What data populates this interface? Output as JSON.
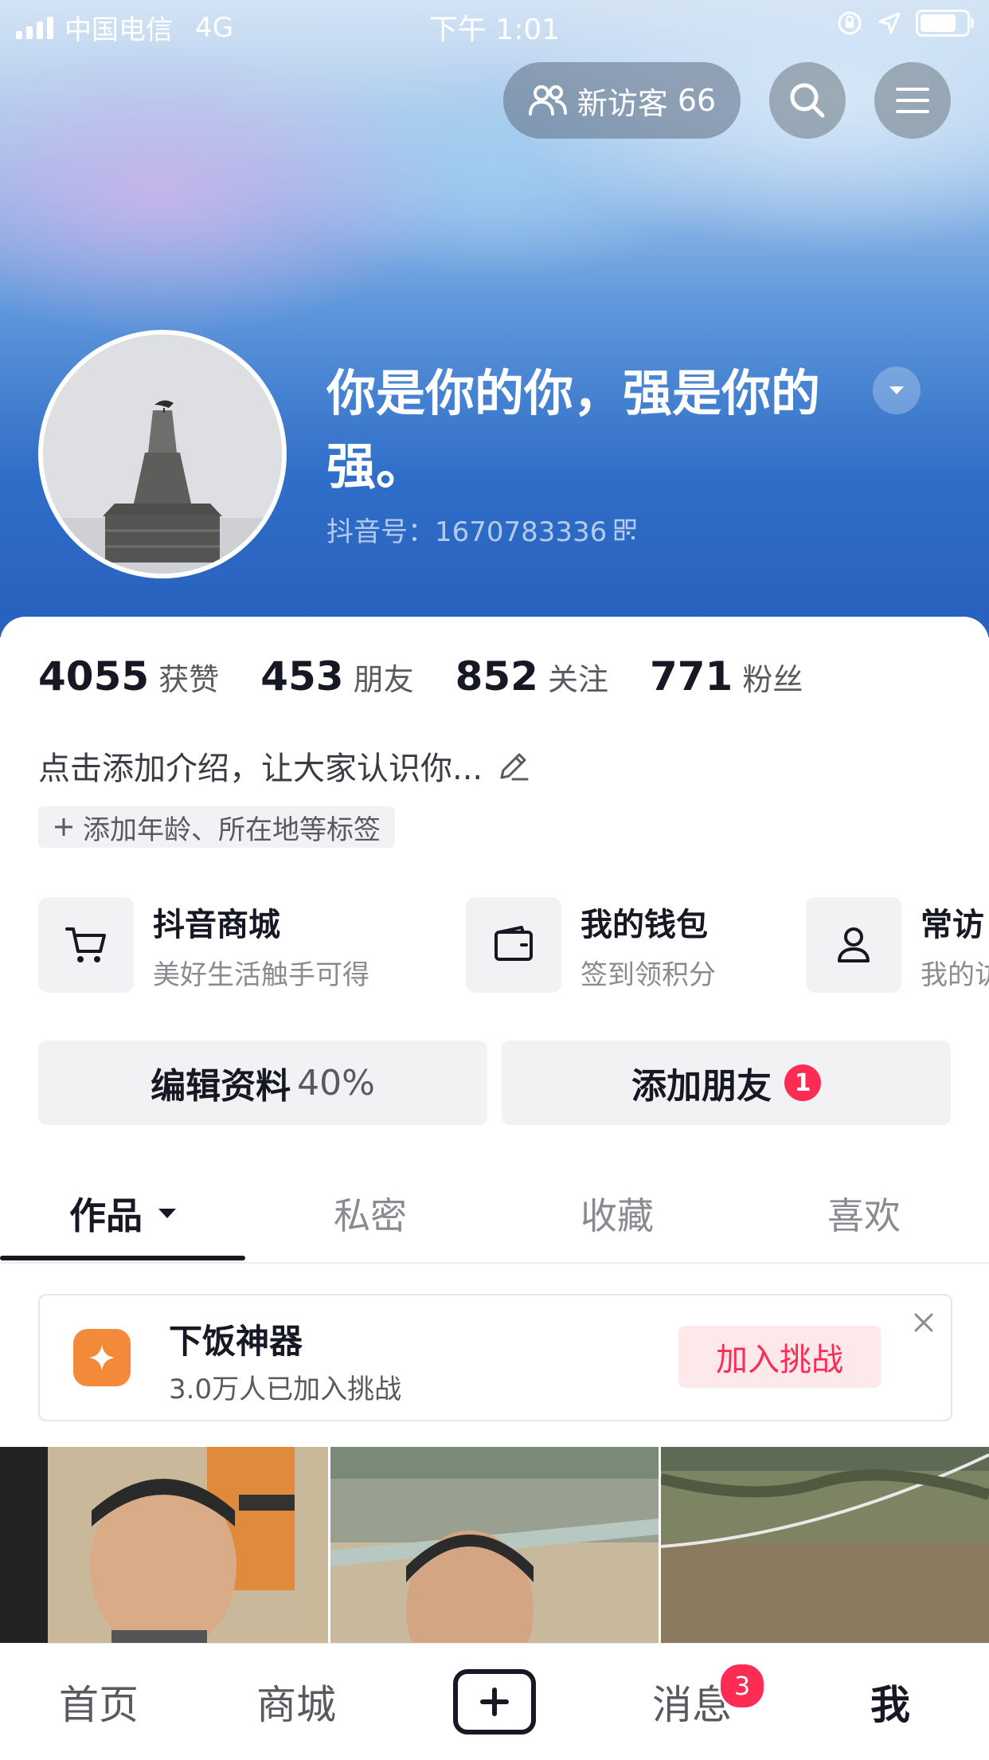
{
  "status_bar": {
    "carrier": "中国电信",
    "network": "4G",
    "time": "下午 1:01"
  },
  "header": {
    "visitors_label": "新访客",
    "visitors_count": "66"
  },
  "profile": {
    "nickname": "你是你的你，强是你的强。",
    "douyin_id": "抖音号：1670783336"
  },
  "stats": [
    {
      "num": "4055",
      "label": "获赞"
    },
    {
      "num": "453",
      "label": "朋友"
    },
    {
      "num": "852",
      "label": "关注"
    },
    {
      "num": "771",
      "label": "粉丝"
    }
  ],
  "bio": {
    "placeholder": "点击添加介绍，让大家认识你..."
  },
  "tag_chip": {
    "label": "添加年龄、所在地等标签"
  },
  "services": [
    {
      "title": "抖音商城",
      "subtitle": "美好生活触手可得",
      "icon": "cart-icon"
    },
    {
      "title": "我的钱包",
      "subtitle": "签到领积分",
      "icon": "wallet-icon"
    },
    {
      "title": "常访",
      "subtitle": "我的访",
      "icon": "person-icon"
    }
  ],
  "actions": {
    "edit_label": "编辑资料",
    "edit_percent": "40%",
    "add_friend_label": "添加朋友",
    "add_friend_badge": "1"
  },
  "tabs": [
    {
      "label": "作品",
      "active": true
    },
    {
      "label": "私密",
      "active": false
    },
    {
      "label": "收藏",
      "active": false
    },
    {
      "label": "喜欢",
      "active": false
    }
  ],
  "challenge": {
    "title": "下饭神器",
    "subtitle": "3.0万人已加入挑战",
    "join_label": "加入挑战"
  },
  "bottom_nav": {
    "home": "首页",
    "mall": "商城",
    "messages": "消息",
    "messages_badge": "3",
    "me": "我"
  },
  "colors": {
    "accent": "#fe2c55",
    "challenge_icon": "#f28a3a",
    "hero_blue": "#2f6ec8"
  }
}
